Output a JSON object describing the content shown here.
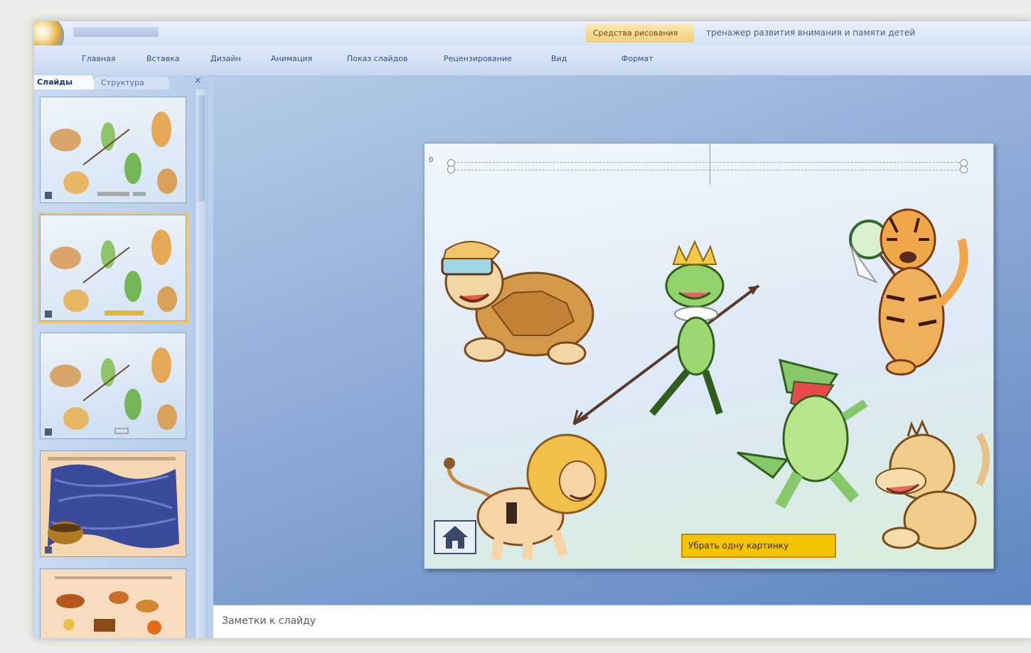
{
  "title_bar": {
    "context_tab": "Средства рисования",
    "document_title": "тренажер развития внимания и памяти детей"
  },
  "ribbon": {
    "tabs": [
      "Главная",
      "Вставка",
      "Дизайн",
      "Анимация",
      "Показ слайдов",
      "Рецензирование",
      "Вид",
      "Формат"
    ]
  },
  "left_pane": {
    "tab_slides": "Слайды",
    "tab_outline": "Структура",
    "close_glyph": "×"
  },
  "slide": {
    "remove_button_label": "Убрать одну картинку",
    "anchor_mark": "0",
    "characters": [
      "turtle",
      "frog-with-spear",
      "tiger-with-net",
      "crocodile",
      "lion",
      "monkey"
    ]
  },
  "notes": {
    "placeholder": "Заметки к слайду"
  },
  "colors": {
    "accent_orange": "#f3c66b",
    "button_yellow": "#f5c400",
    "main_blue": "#5f86c2"
  }
}
